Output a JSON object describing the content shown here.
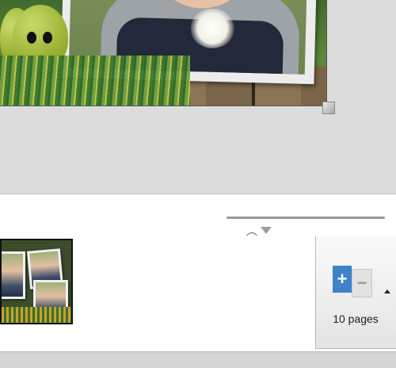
{
  "zoom": {
    "level_fraction": 0.16,
    "default_marker_fraction": 0.25
  },
  "pages_panel": {
    "add_icon": "plus-icon",
    "remove_icon": "minus-icon",
    "add_glyph": "+",
    "remove_glyph": "−",
    "label": "10 pages"
  },
  "colors": {
    "add_page_blue": "#3f82c8",
    "canvas_bg": "#dcdcdc",
    "thumb_border": "#111111"
  }
}
